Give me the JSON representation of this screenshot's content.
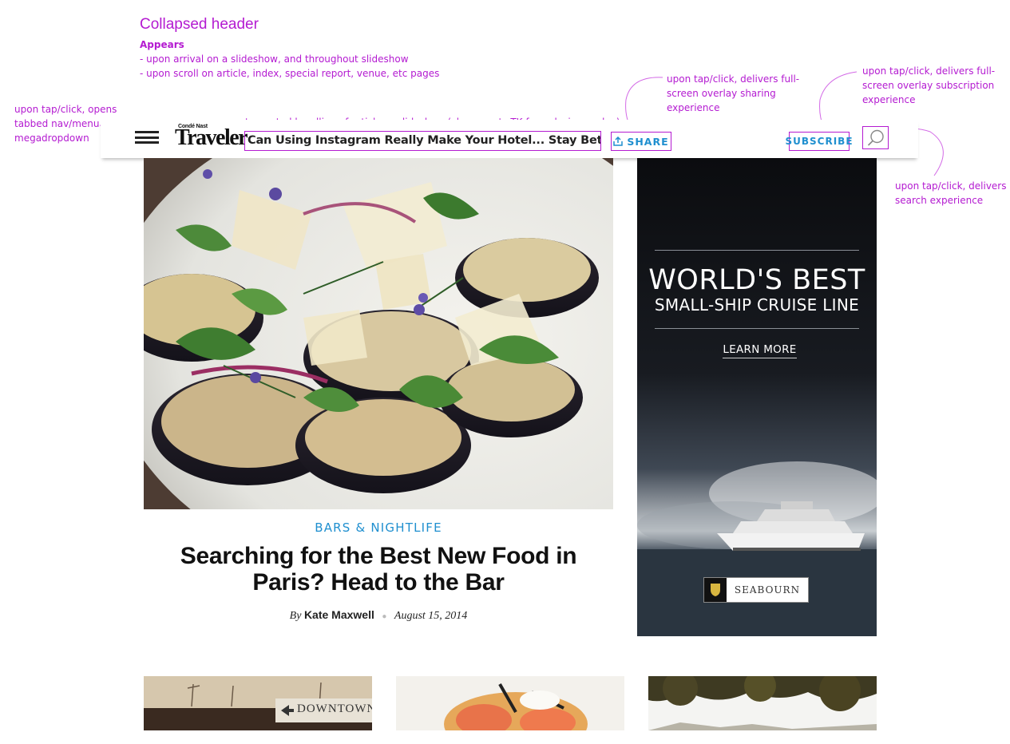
{
  "annotations": {
    "title": "Collapsed header",
    "appears_heading": "Appears",
    "appears_items": [
      "- upon arrival on a slideshow, and throughout slideshow",
      "- upon scroll on article, index, special report, venue, etc pages"
    ],
    "nav_note": "upon tap/click, opens tabbed nav/menu megadropdown",
    "headline_note": "truncated headline of article or slideshow (char counts TK from design or dev)",
    "share_note": "upon tap/click, delivers full-screen overlay sharing experience",
    "subscribe_note": "upon tap/click, delivers full-screen overlay subscription experience",
    "search_note": "upon tap/click, delivers search experience",
    "color": "#b41bd1"
  },
  "header": {
    "logo_small": "Condé Nast",
    "logo_big": "Traveler",
    "truncated_headline": "Can Using Instagram Really Make Your Hotel... Stay Better",
    "share_label": "SHARE",
    "subscribe_label": "SUBSCRIBE",
    "menu_icon": "hamburger-icon",
    "search_icon": "search-icon",
    "share_icon": "share-icon",
    "accent": "#1f8fcf"
  },
  "article": {
    "category": "BARS & NIGHTLIFE",
    "title": "Searching for the Best New Food in Paris? Head to the Bar",
    "byline_prefix": "By",
    "author": "Kate Maxwell",
    "date": "August 15, 2014"
  },
  "ad": {
    "headline": "WORLD'S BEST",
    "subheadline": "SMALL-SHIP CRUISE LINE",
    "cta": "LEARN MORE",
    "brand": "SEABOURN"
  },
  "thumbnails": {
    "first_sign": "DOWNTOWN"
  }
}
